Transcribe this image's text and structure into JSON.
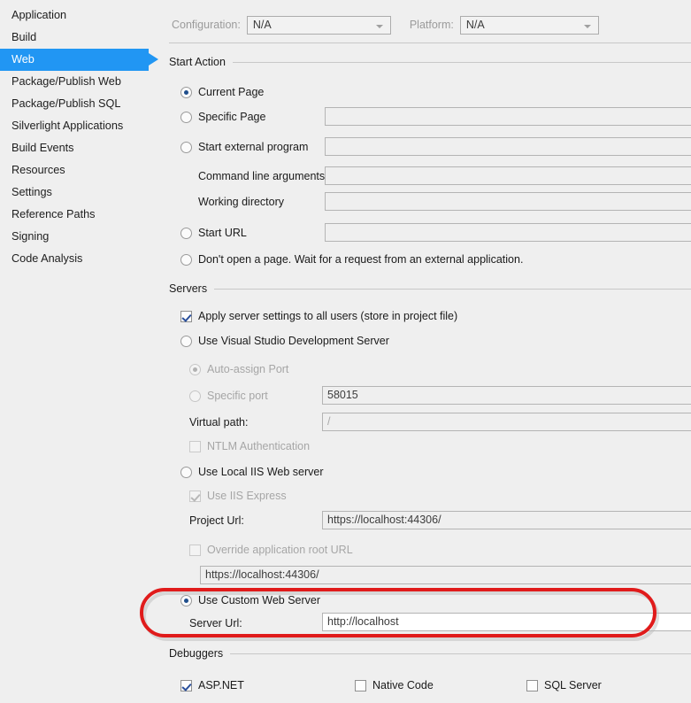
{
  "sidebar": {
    "items": [
      {
        "label": "Application",
        "selected": false
      },
      {
        "label": "Build",
        "selected": false
      },
      {
        "label": "Web",
        "selected": true
      },
      {
        "label": "Package/Publish Web",
        "selected": false
      },
      {
        "label": "Package/Publish SQL",
        "selected": false
      },
      {
        "label": "Silverlight Applications",
        "selected": false
      },
      {
        "label": "Build Events",
        "selected": false
      },
      {
        "label": "Resources",
        "selected": false
      },
      {
        "label": "Settings",
        "selected": false
      },
      {
        "label": "Reference Paths",
        "selected": false
      },
      {
        "label": "Signing",
        "selected": false
      },
      {
        "label": "Code Analysis",
        "selected": false
      }
    ]
  },
  "toolbar": {
    "configuration_label": "Configuration:",
    "configuration_value": "N/A",
    "platform_label": "Platform:",
    "platform_value": "N/A"
  },
  "start_action": {
    "header": "Start Action",
    "current_page_label": "Current Page",
    "specific_page_label": "Specific Page",
    "specific_page_value": "",
    "start_external_program_label": "Start external program",
    "start_external_program_value": "",
    "command_line_arguments_label": "Command line arguments",
    "command_line_arguments_value": "",
    "working_directory_label": "Working directory",
    "working_directory_value": "",
    "start_url_label": "Start URL",
    "start_url_value": "",
    "dont_open_page_label": "Don't open a page.  Wait for a request from an external application."
  },
  "servers": {
    "header": "Servers",
    "apply_server_settings_label": "Apply server settings to all users (store in project file)",
    "use_vs_dev_server_label": "Use Visual Studio Development Server",
    "auto_assign_port_label": "Auto-assign Port",
    "specific_port_label": "Specific port",
    "specific_port_value": "58015",
    "virtual_path_label": "Virtual path:",
    "virtual_path_value": "/",
    "ntlm_authentication_label": "NTLM Authentication",
    "use_local_iis_label": "Use Local IIS Web server",
    "use_iis_express_label": "Use IIS Express",
    "project_url_label": "Project Url:",
    "project_url_value": "https://localhost:44306/",
    "override_app_root_label": "Override application root URL",
    "override_app_root_value": "https://localhost:44306/",
    "use_custom_web_server_label": "Use Custom Web Server",
    "server_url_label": "Server Url:",
    "server_url_value": "http://localhost"
  },
  "debuggers": {
    "header": "Debuggers",
    "aspnet_label": "ASP.NET",
    "native_code_label": "Native Code",
    "sql_server_label": "SQL Server"
  },
  "annotation": {
    "color": "#e01b1b",
    "shape": "rounded-ellipse-highlight"
  },
  "colors": {
    "accent": "#2196f3",
    "window_bg": "#efefef",
    "radio_dot": "#1f4e8c",
    "check_mark": "#2a4f9b",
    "annotation_red": "#e01b1b"
  }
}
